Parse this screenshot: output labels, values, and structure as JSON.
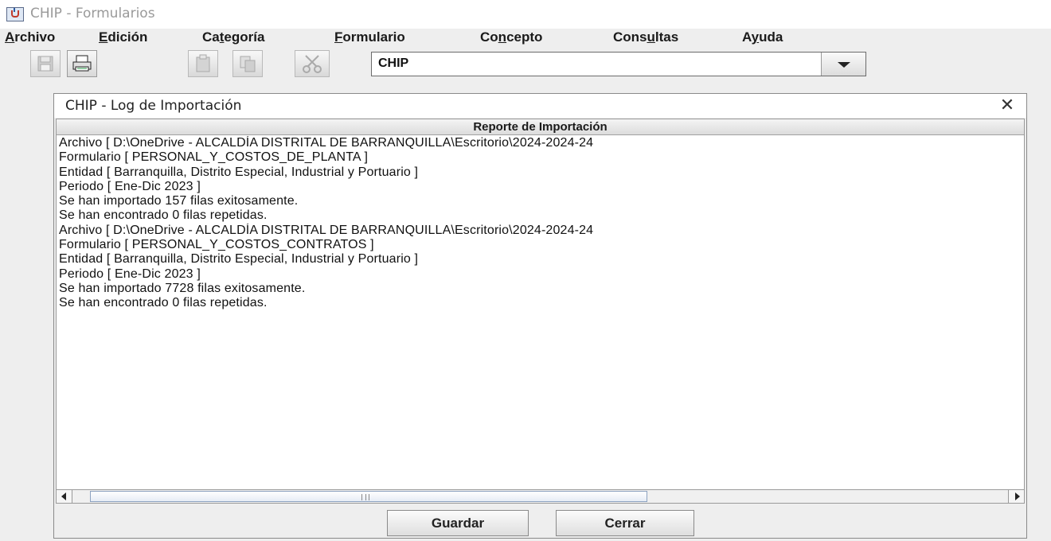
{
  "window": {
    "title": "CHIP - Formularios"
  },
  "menubar": {
    "items": [
      {
        "mn": "A",
        "rest": "rchivo"
      },
      {
        "mn": "E",
        "rest": "dición"
      },
      {
        "pre": "Ca",
        "mn": "t",
        "rest": "egoría"
      },
      {
        "mn": "F",
        "rest": "ormulario"
      },
      {
        "pre": "Co",
        "mn": "n",
        "rest": "cepto"
      },
      {
        "pre": "Cons",
        "mn": "u",
        "rest": "ltas"
      },
      {
        "pre": "A",
        "mn": "y",
        "rest": "uda"
      }
    ]
  },
  "toolbar": {
    "buttons": [
      {
        "icon": "save-icon",
        "enabled": false
      },
      {
        "icon": "print-icon",
        "enabled": true
      },
      {
        "icon": "paste-icon",
        "enabled": false
      },
      {
        "icon": "copy-icon",
        "enabled": false
      },
      {
        "icon": "cut-icon",
        "enabled": false
      }
    ],
    "combo_value": "CHIP"
  },
  "dialog": {
    "title": "CHIP - Log de Importación",
    "close_symbol": "✕",
    "column_header": "Reporte de Importación",
    "lines": [
      "Archivo [ D:\\OneDrive - ALCALDÍA DISTRITAL DE BARRANQUILLA\\Escritorio\\2024-2024-24",
      "Formulario [ PERSONAL_Y_COSTOS_DE_PLANTA ]",
      "Entidad [ Barranquilla, Distrito Especial, Industrial y Portuario ]",
      "Periodo [ Ene-Dic 2023 ]",
      "Se han importado 157 filas exitosamente.",
      "Se han encontrado 0 filas repetidas.",
      "Archivo [ D:\\OneDrive - ALCALDÍA DISTRITAL DE BARRANQUILLA\\Escritorio\\2024-2024-24",
      "Formulario [ PERSONAL_Y_COSTOS_CONTRATOS ]",
      "Entidad [ Barranquilla, Distrito Especial, Industrial y Portuario ]",
      "Periodo [ Ene-Dic 2023 ]",
      "Se han importado 7728 filas exitosamente.",
      "Se han encontrado 0 filas repetidas."
    ],
    "scrollbar": {
      "grip_label": "III"
    },
    "buttons": {
      "save": "Guardar",
      "close": "Cerrar"
    }
  }
}
